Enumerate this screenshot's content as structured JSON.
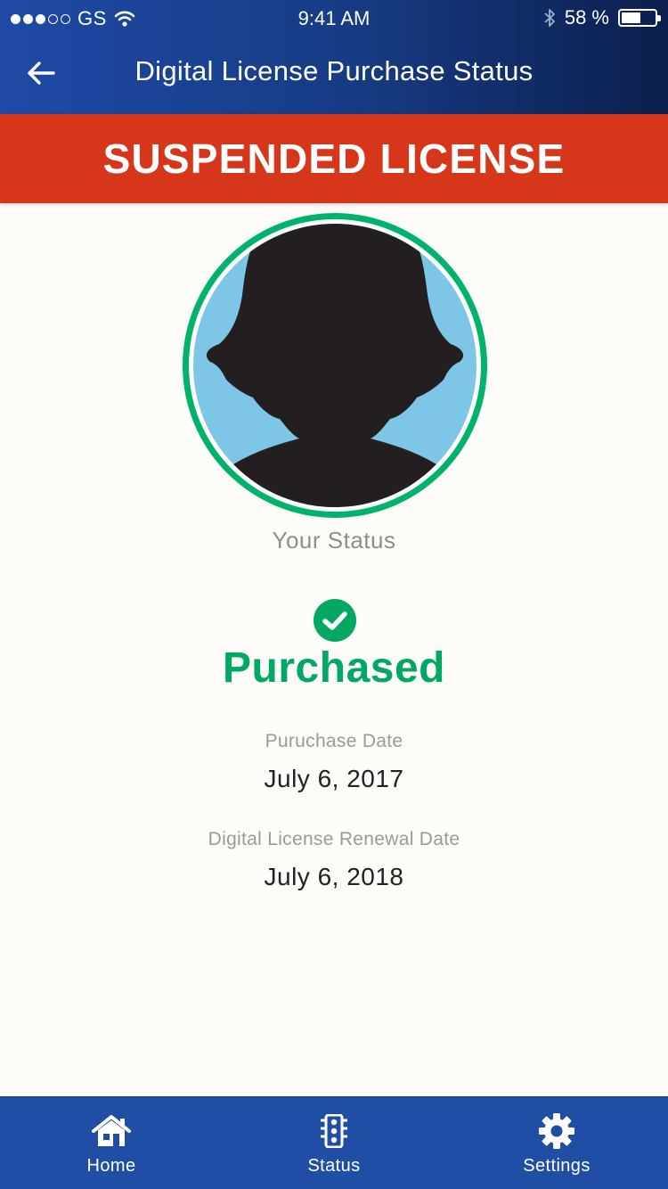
{
  "status_bar": {
    "carrier": "GS",
    "time": "9:41 AM",
    "battery": "58 %",
    "battery_level": 0.58
  },
  "nav": {
    "title": "Digital License Purchase Status"
  },
  "banner": {
    "text": "SUSPENDED LICENSE",
    "color": "#d6361a"
  },
  "profile": {
    "caption": "Your Status",
    "ring_color": "#00b36b"
  },
  "status": {
    "label": "Purchased",
    "color": "#00a862",
    "icon": "check-circle-icon"
  },
  "dates": [
    {
      "label": "Puruchase Date",
      "value": "July 6, 2017"
    },
    {
      "label": "Digital License Renewal Date",
      "value": "July 6, 2018"
    }
  ],
  "tabbar": {
    "items": [
      {
        "label": "Home",
        "icon": "home-icon"
      },
      {
        "label": "Status",
        "icon": "traffic-light-icon"
      },
      {
        "label": "Settings",
        "icon": "gear-icon"
      }
    ]
  }
}
